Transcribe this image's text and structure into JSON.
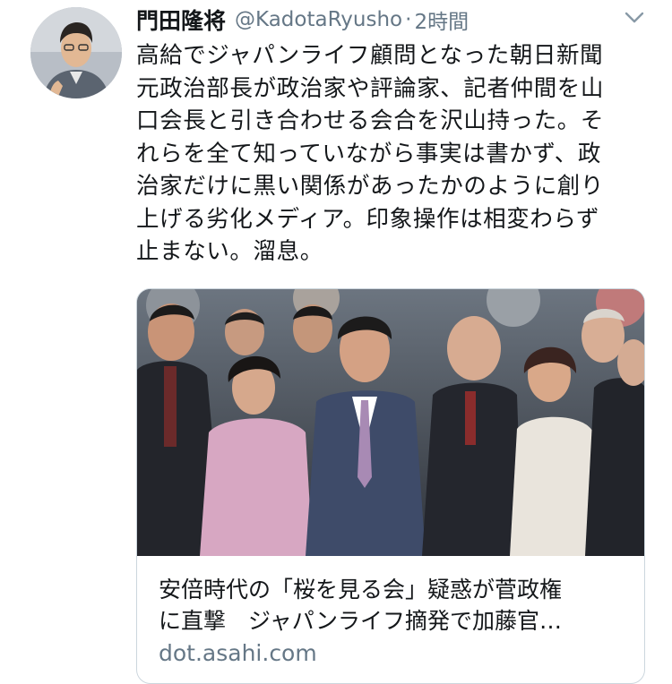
{
  "tweet": {
    "author_name": "門田隆将",
    "handle": "@KadotaRyusho",
    "separator": "·",
    "time": "2時間",
    "text": "高給でジャパンライフ顧問となった朝日新聞\n元政治部長が政治家や評論家、記者仲間を山\n口会長と引き合わせる会合を沢山持った。そ\nれらを全て知っていながら事実は書かず、政\n治家だけに黒い関係があったかのように創り\n上げる劣化メディア。印象操作は相変わらず\n止まない。溜息。"
  },
  "link_card": {
    "title": "安倍時代の「桜を見る会」疑惑が菅政権\nに直撃　ジャパンライフ摘発で加藤官…",
    "domain": "dot.asahi.com"
  },
  "icons": {
    "menu": "chevron-down-icon",
    "avatar": "profile-photo"
  },
  "colors": {
    "text": "#14171a",
    "secondary_text": "#657786",
    "card_border": "#ccd6dd"
  }
}
